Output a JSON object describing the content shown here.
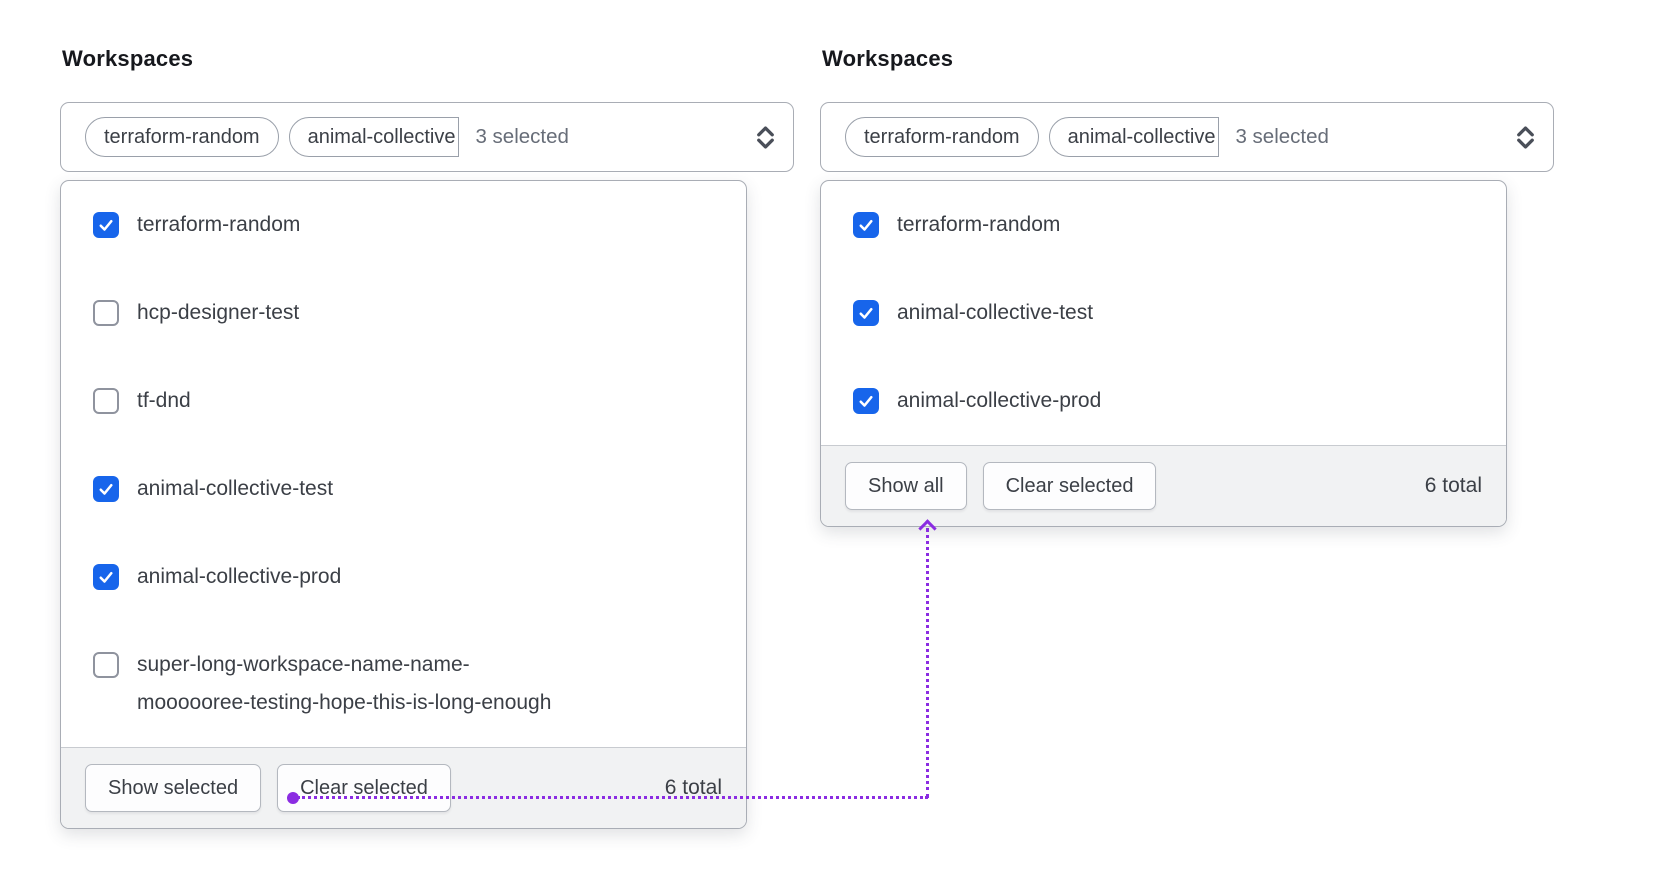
{
  "colors": {
    "accent-blue": "#1765eb",
    "annotation-purple": "#8b2ce2"
  },
  "panels": [
    {
      "title": "Workspaces",
      "trigger": {
        "tags": [
          "terraform-random",
          "animal-collective"
        ],
        "summary": "3 selected"
      },
      "options": [
        {
          "label": "terraform-random",
          "checked": true
        },
        {
          "label": "hcp-designer-test",
          "checked": false
        },
        {
          "label": "tf-dnd",
          "checked": false
        },
        {
          "label": "animal-collective-test",
          "checked": true
        },
        {
          "label": "animal-collective-prod",
          "checked": true
        },
        {
          "label": "super-long-workspace-name-name-moooooree-testing-hope-this-is-long-enough",
          "label_lines": [
            "super-long-workspace-name-name-",
            "moooooree-testing-hope-this-is-long-enough"
          ],
          "checked": false
        }
      ],
      "footer": {
        "show_button": "Show selected",
        "clear_button": "Clear selected",
        "total": "6 total"
      }
    },
    {
      "title": "Workspaces",
      "trigger": {
        "tags": [
          "terraform-random",
          "animal-collective"
        ],
        "summary": "3 selected"
      },
      "options": [
        {
          "label": "terraform-random",
          "checked": true
        },
        {
          "label": "animal-collective-test",
          "checked": true
        },
        {
          "label": "animal-collective-prod",
          "checked": true
        }
      ],
      "footer": {
        "show_button": "Show all",
        "clear_button": "Clear selected",
        "total": "6 total"
      }
    }
  ],
  "annotation": {
    "type": "dotted-arrow",
    "from": "Show selected button",
    "to": "Show all button"
  }
}
